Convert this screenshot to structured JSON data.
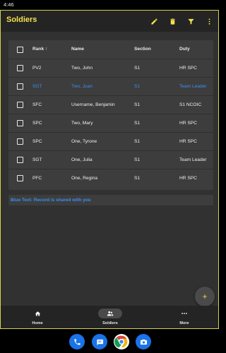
{
  "status_bar": {
    "time": "4:46"
  },
  "app_bar": {
    "title": "Soldiers",
    "actions": [
      {
        "name": "edit-icon"
      },
      {
        "name": "delete-icon"
      },
      {
        "name": "filter-icon"
      },
      {
        "name": "more-vert-icon"
      }
    ]
  },
  "table": {
    "columns": {
      "rank": "Rank",
      "name": "Name",
      "section": "Section",
      "duty": "Duty",
      "sort_indicator": "↑"
    },
    "rows": [
      {
        "rank": "PV2",
        "name": "Two, John",
        "section": "S1",
        "duty": "HR SPC",
        "shared": false
      },
      {
        "rank": "SGT",
        "name": "Two, Juan",
        "section": "S1",
        "duty": "Team Leader",
        "shared": true
      },
      {
        "rank": "SFC",
        "name": "Username, Benjamin",
        "section": "S1",
        "duty": "S1 NCOIC",
        "shared": false
      },
      {
        "rank": "SPC",
        "name": "Two, Mary",
        "section": "S1",
        "duty": "HR SPC",
        "shared": false
      },
      {
        "rank": "SPC",
        "name": "One, Tyrone",
        "section": "S1",
        "duty": "HR SPC",
        "shared": false
      },
      {
        "rank": "SGT",
        "name": "One, Julia",
        "section": "S1",
        "duty": "Team Leader",
        "shared": false
      },
      {
        "rank": "PFC",
        "name": "One, Regina",
        "section": "S1",
        "duty": "HR SPC",
        "shared": false
      }
    ]
  },
  "note": "Blue Text: Record is shared with you",
  "fab": {
    "icon": "add-icon"
  },
  "bottom_nav": [
    {
      "label": "Home",
      "icon": "home-icon",
      "active": false
    },
    {
      "label": "Soldiers",
      "icon": "people-icon",
      "active": true
    },
    {
      "label": "More",
      "icon": "more-horiz-icon",
      "active": false
    }
  ],
  "dock": [
    {
      "icon": "phone-icon"
    },
    {
      "icon": "messages-icon"
    },
    {
      "icon": "chrome-icon"
    },
    {
      "icon": "camera-icon"
    }
  ],
  "colors": {
    "accent": "#f4e04d",
    "shared_text": "#3b8ef0",
    "surface": "#3d3d3d",
    "background": "#313131"
  }
}
